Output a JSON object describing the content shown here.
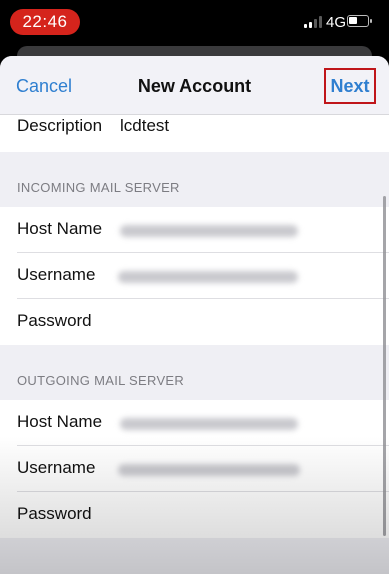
{
  "status_bar": {
    "time": "22:46",
    "network": "4G"
  },
  "nav": {
    "cancel": "Cancel",
    "title": "New Account",
    "next": "Next"
  },
  "description": {
    "label": "Description",
    "value": "lcdtest"
  },
  "incoming": {
    "header": "INCOMING MAIL SERVER",
    "host_label": "Host Name",
    "username_label": "Username",
    "password_label": "Password"
  },
  "outgoing": {
    "header": "OUTGOING MAIL SERVER",
    "host_label": "Host Name",
    "username_label": "Username",
    "password_label": "Password"
  },
  "colors": {
    "accent": "#2f7fd0",
    "highlight_border": "#c0161a",
    "time_pill": "#d5241c"
  }
}
